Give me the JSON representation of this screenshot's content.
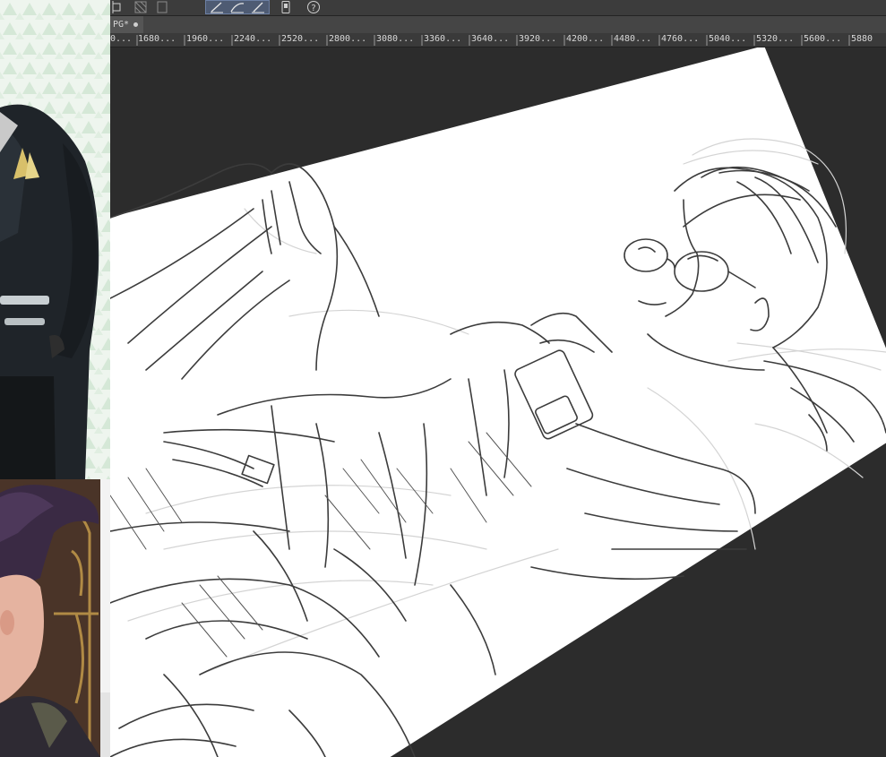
{
  "app": {
    "document_tab_label": "PG*"
  },
  "toolbar": {
    "icons": [
      "transform-icon",
      "grid-icon",
      "frame-icon",
      "pen-tool-icon",
      "curve-tool-icon",
      "line-tool-icon",
      "device-icon",
      "help-icon"
    ]
  },
  "ruler": {
    "labels": [
      "0...",
      "1680...",
      "1960...",
      "2240...",
      "2520...",
      "2800...",
      "3080...",
      "3360...",
      "3640...",
      "3920...",
      "4200...",
      "4480...",
      "4760...",
      "5040...",
      "5320...",
      "5600...",
      "5880"
    ]
  },
  "canvas": {
    "background_color": "#2c2c2c",
    "paper_color": "#ffffff",
    "sketch_color": "#3a3a3a",
    "rotation_degrees": -28
  },
  "reference_images": {
    "top": "character-in-black-suit-reference",
    "bottom": "character-with-purple-hair-reference"
  }
}
